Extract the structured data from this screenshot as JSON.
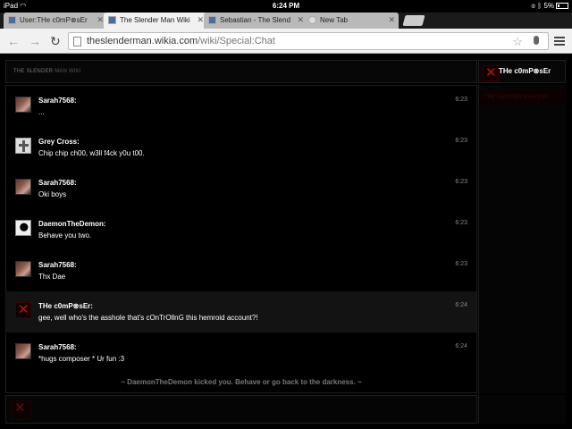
{
  "status_bar": {
    "device": "iPad",
    "wifi_icon": "wifi-icon",
    "time": "6:24 PM",
    "battery": "5%"
  },
  "tabs": [
    {
      "label": "User:THe c0mP⊗sEr",
      "active": false,
      "favicon": "wikia-favicon"
    },
    {
      "label": "The Slender Man Wiki",
      "active": true,
      "favicon": "wikia-favicon"
    },
    {
      "label": "Sebastian - The Slend",
      "active": false,
      "favicon": "wikia-favicon"
    },
    {
      "label": "New Tab",
      "active": false,
      "favicon": "newtab-favicon"
    }
  ],
  "toolbar": {
    "url_domain": "theslenderman.wikia.com",
    "url_path": "/wiki/Special:Chat"
  },
  "chat": {
    "header_title": "THE SLENDER",
    "header_wiki": "MAN WIKI",
    "current_user": "THe c0mP⊗sEr",
    "userlist_entry": "THE SLENDER MAN WIKI",
    "messages": [
      {
        "user": "Sarah7568:",
        "text": "...",
        "time": "6:23",
        "avatar": "sarah"
      },
      {
        "user": "Grey Cross:",
        "text": "Chip chip ch00, w3ll f4ck y0u t00.",
        "time": "6:23",
        "avatar": "grey"
      },
      {
        "user": "Sarah7568:",
        "text": "Oki boys",
        "time": "6:23",
        "avatar": "sarah"
      },
      {
        "user": "DaemonTheDemon:",
        "text": "Behave you two.",
        "time": "6:23",
        "avatar": "daemon"
      },
      {
        "user": "Sarah7568:",
        "text": "Thx Dae",
        "time": "6:23",
        "avatar": "sarah"
      },
      {
        "user": "THe c0mP⊗sEr:",
        "text": "gee, well who's the asshole that's cOnTrOllnG this hemroid account?!",
        "time": "6:24",
        "avatar": "composer"
      },
      {
        "user": "Sarah7568:",
        "text": "*hugs composer * Ur fun :3",
        "time": "6:24",
        "avatar": "sarah"
      }
    ],
    "inline_alert": "~ DaemonTheDemon kicked you. Behave or go back to the darkness. ~"
  }
}
